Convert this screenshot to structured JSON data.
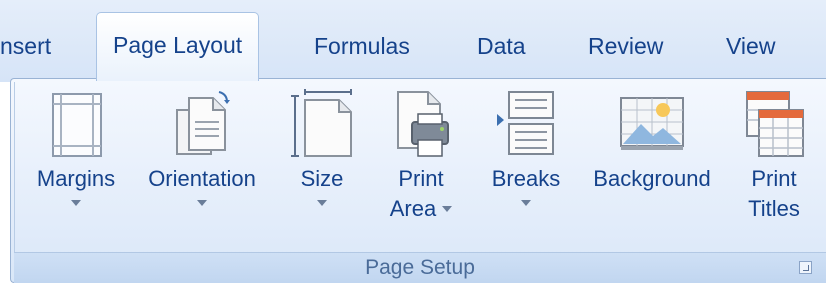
{
  "tabs": [
    {
      "label": "nsert"
    },
    {
      "label": "Page Layout"
    },
    {
      "label": "Formulas"
    },
    {
      "label": "Data"
    },
    {
      "label": "Review"
    },
    {
      "label": "View"
    }
  ],
  "group": {
    "label": "Page Setup",
    "commands": [
      {
        "line1": "Margins",
        "icon": "margins-icon"
      },
      {
        "line1": "Orientation",
        "icon": "orientation-icon"
      },
      {
        "line1": "Size",
        "icon": "size-icon"
      },
      {
        "line1": "Print",
        "line2": "Area",
        "icon": "print-area-icon"
      },
      {
        "line1": "Breaks",
        "icon": "breaks-icon"
      },
      {
        "line1": "Background",
        "icon": "background-icon"
      },
      {
        "line1": "Print",
        "line2": "Titles",
        "icon": "print-titles-icon"
      }
    ]
  },
  "colors": {
    "accent": "#15428b",
    "ribbon": "#dfe9f8",
    "group_label": "#4a6b98"
  }
}
